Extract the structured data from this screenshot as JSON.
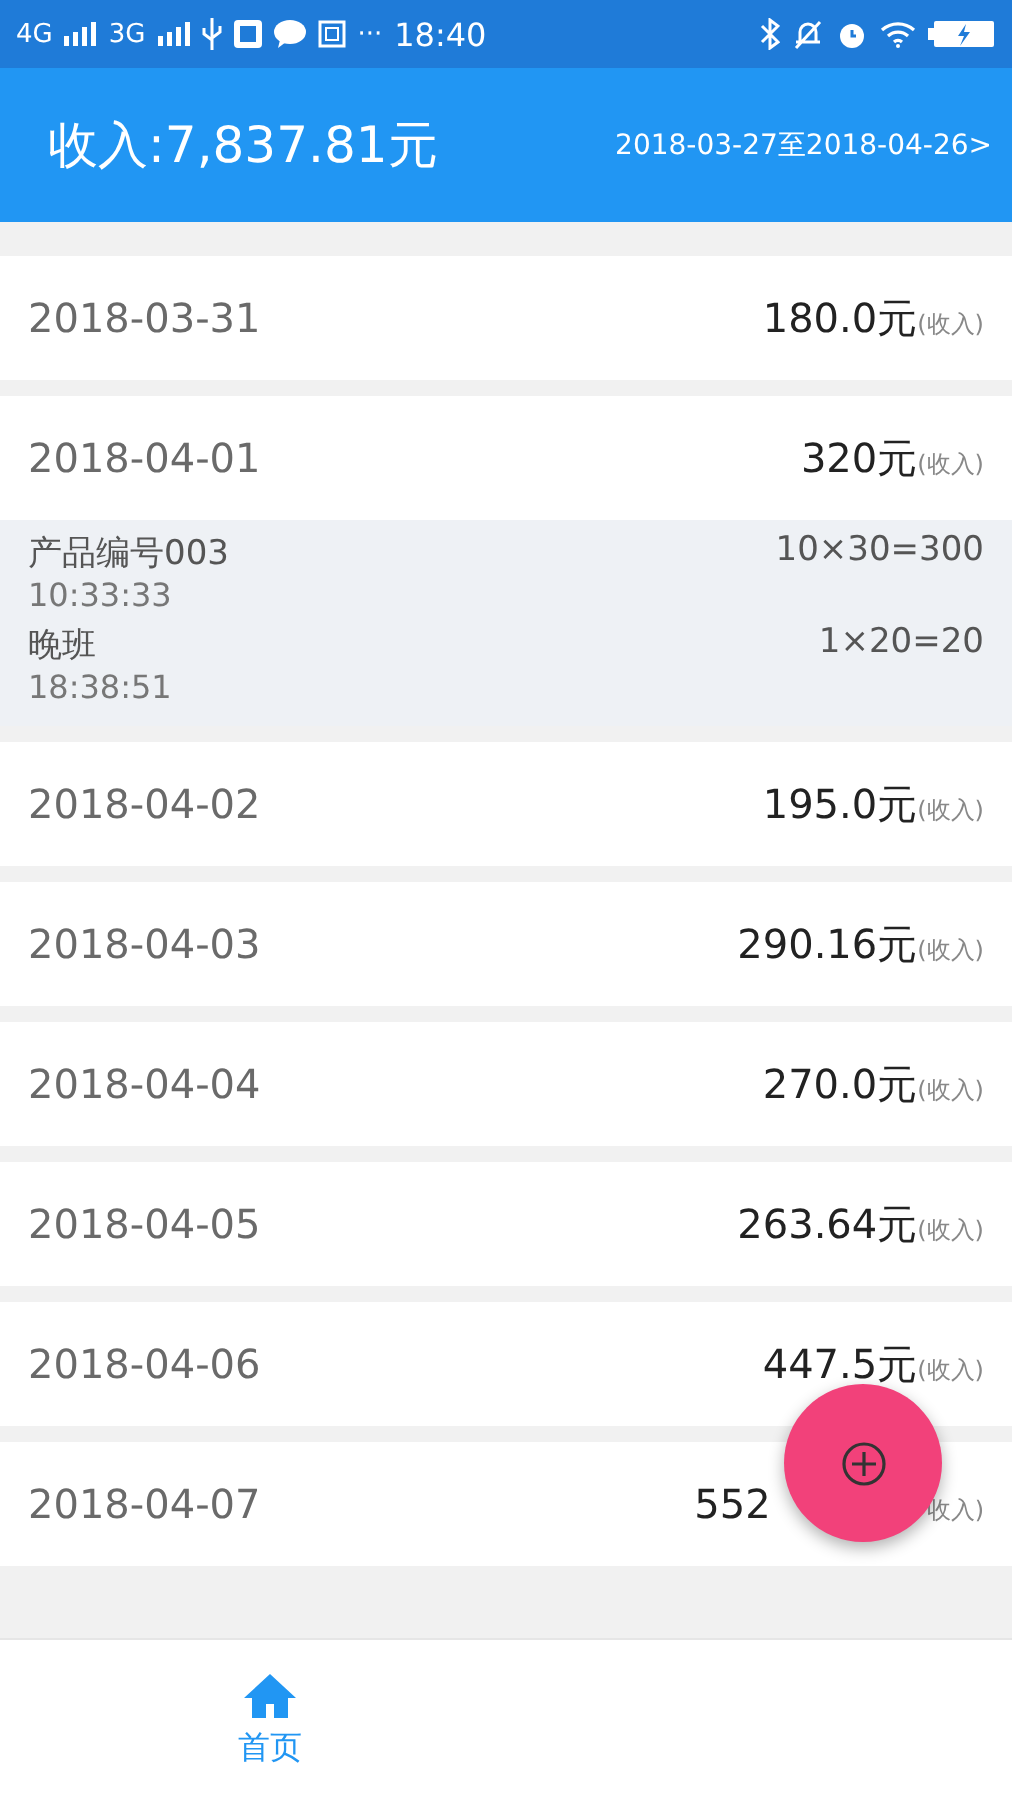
{
  "status_bar": {
    "left": [
      "4G",
      "3G"
    ],
    "more": "···",
    "time": "18:40"
  },
  "header": {
    "title": "收入:7,837.81元",
    "range": "2018-03-27至2018-04-26>"
  },
  "days": [
    {
      "date": "2018-03-31",
      "amount": "180.0元",
      "tag": "(收入)"
    },
    {
      "date": "2018-04-01",
      "amount": "320元",
      "tag": "(收入)",
      "entries": [
        {
          "name": "产品编号003",
          "time": "10:33:33",
          "formula": "10×30=300"
        },
        {
          "name": "晚班",
          "time": "18:38:51",
          "formula": "1×20=20"
        }
      ]
    },
    {
      "date": "2018-04-02",
      "amount": "195.0元",
      "tag": "(收入)"
    },
    {
      "date": "2018-04-03",
      "amount": "290.16元",
      "tag": "(收入)"
    },
    {
      "date": "2018-04-04",
      "amount": "270.0元",
      "tag": "(收入)"
    },
    {
      "date": "2018-04-05",
      "amount": "263.64元",
      "tag": "(收入)"
    },
    {
      "date": "2018-04-06",
      "amount": "447.5元",
      "tag": "(收入)"
    },
    {
      "date": "2018-04-07",
      "amount": "552",
      "tag": "收入)",
      "kind": "covered"
    }
  ],
  "bottom_nav": [
    {
      "label": "首页",
      "selected": true
    }
  ]
}
